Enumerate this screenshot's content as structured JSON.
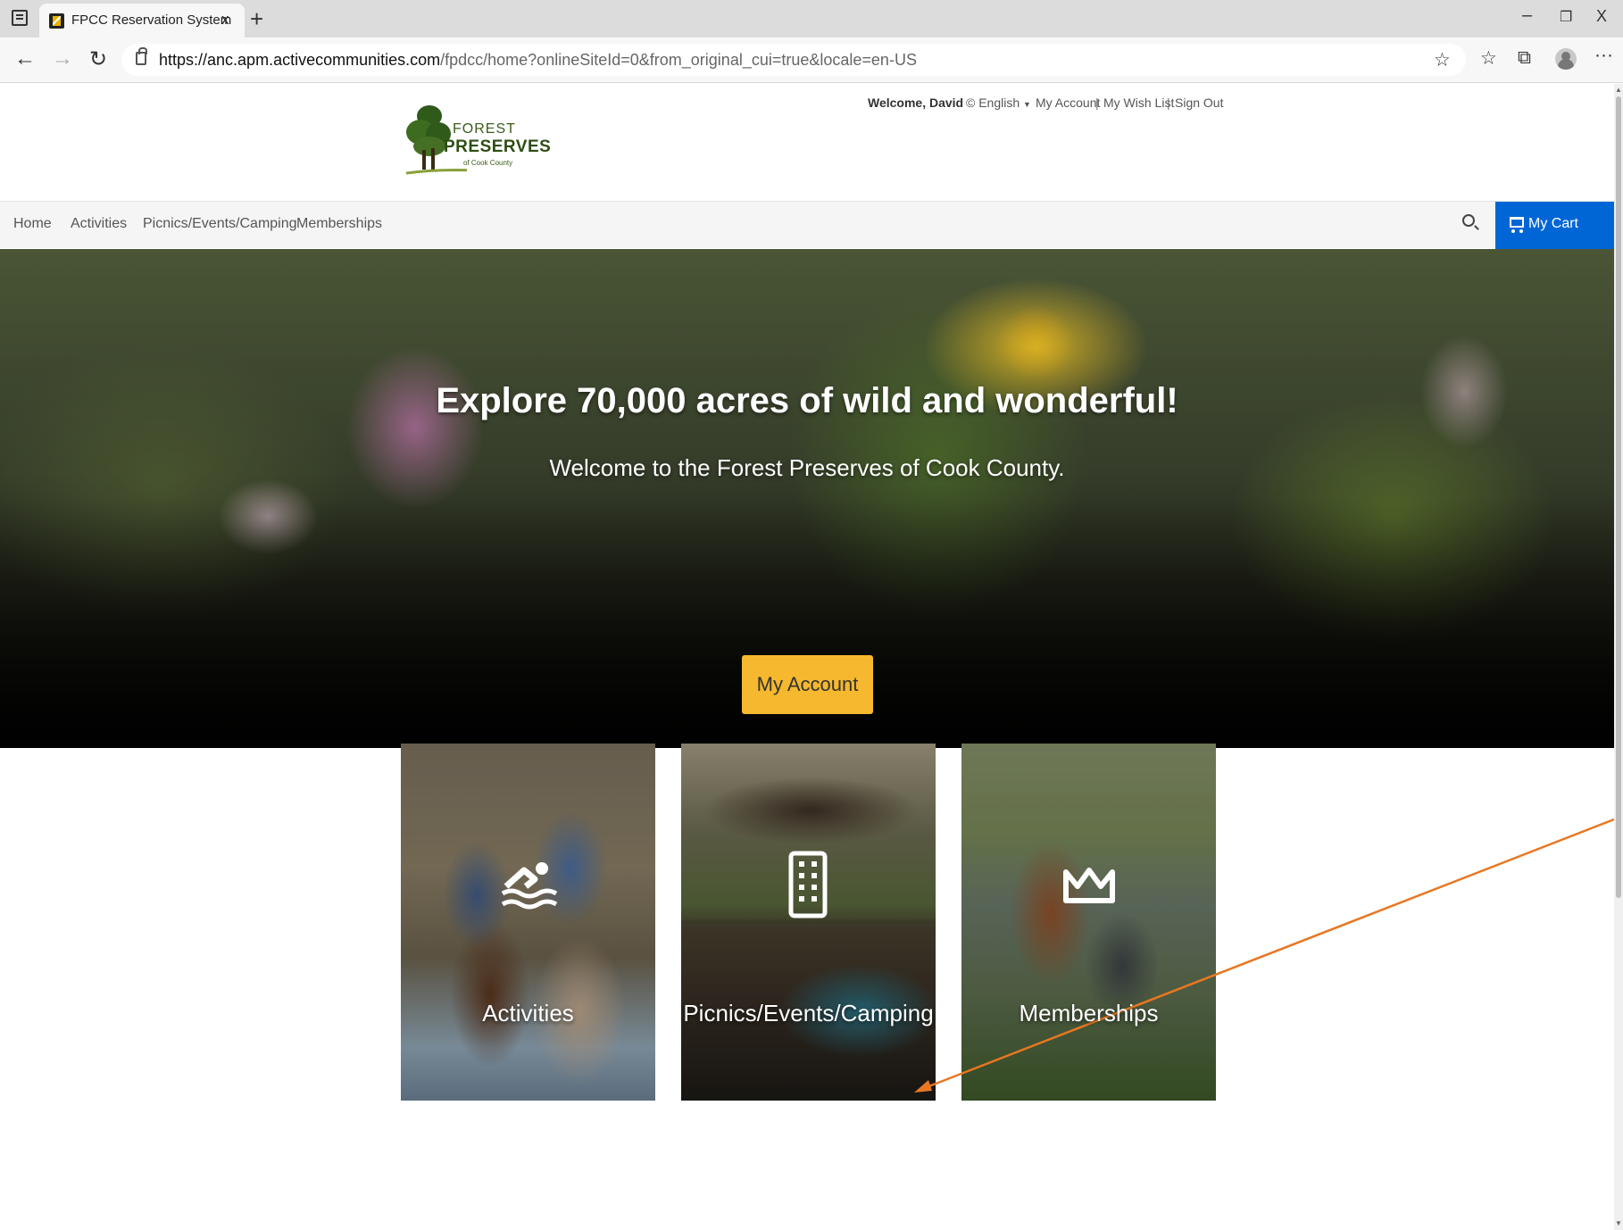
{
  "browser": {
    "tab_title": "FPCC Reservation System",
    "tab_close": "x",
    "new_tab": "+",
    "url_host": "https://anc.apm.activecommunities.com",
    "url_path": "/fpdcc/home?onlineSiteId=0&from_original_cui=true&locale=en-US",
    "window_buttons": [
      "–",
      "❐",
      "X"
    ],
    "menu": "···"
  },
  "header": {
    "logo": {
      "line1": "FOREST",
      "line2": "PRESERVES",
      "line3": "of Cook County"
    },
    "welcome": "Welcome, David",
    "language": "English",
    "my_account": "My Account",
    "wish_list": "My Wish List",
    "sign_out": "Sign Out",
    "sep": "|"
  },
  "nav": {
    "items": [
      {
        "label": "Home"
      },
      {
        "label": "Activities"
      },
      {
        "label": "Picnics/Events/Camping"
      },
      {
        "label": "Memberships"
      }
    ],
    "cart_label": "My Cart"
  },
  "hero": {
    "title": "Explore 70,000 acres of wild and wonderful!",
    "subtitle": "Welcome to the Forest Preserves of Cook County.",
    "button": "My Account"
  },
  "cards": [
    {
      "label": "Activities",
      "icon": "swimmer-icon"
    },
    {
      "label": "Picnics/Events/Camping",
      "icon": "building-icon"
    },
    {
      "label": "Memberships",
      "icon": "crown-icon"
    }
  ],
  "colors": {
    "cart_blue": "#0066d6",
    "hero_button": "#f5b82e",
    "annotation_arrow": "#e87722"
  }
}
